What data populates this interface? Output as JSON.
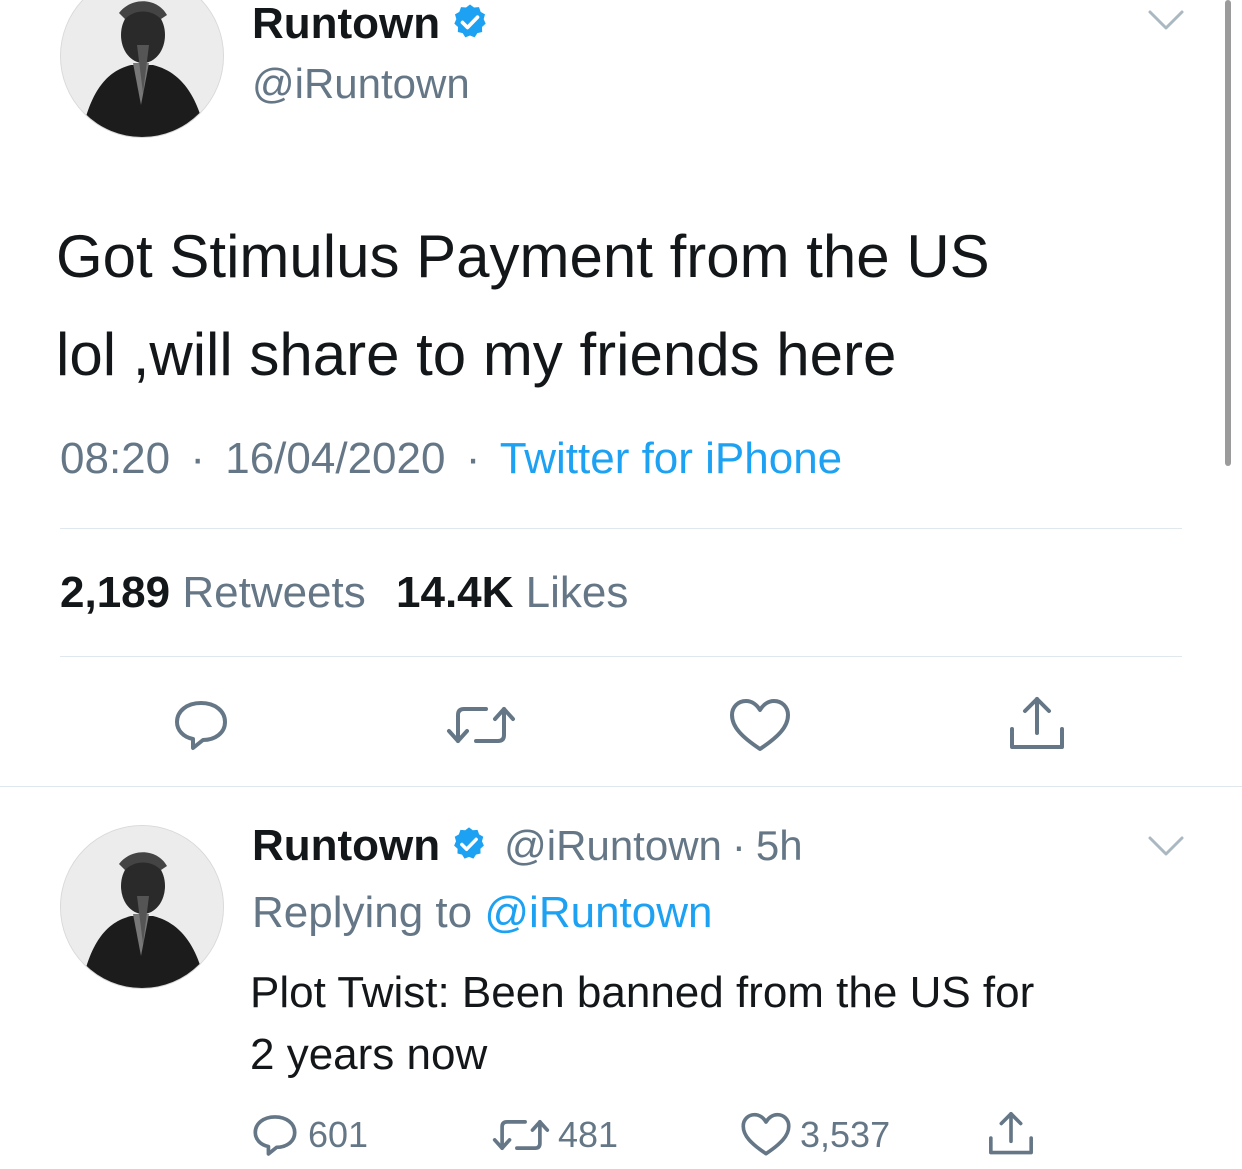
{
  "main_tweet": {
    "display_name": "Runtown",
    "handle": "@iRuntown",
    "text_line1": "Got Stimulus Payment from the US",
    "text_line2": "lol ,will share to my friends here",
    "time": "08:20",
    "date": "16/04/2020",
    "source": "Twitter for iPhone",
    "separator": "·",
    "retweets_count": "2,189",
    "retweets_label": "Retweets",
    "likes_count": "14.4K",
    "likes_label": "Likes"
  },
  "reply_tweet": {
    "display_name": "Runtown",
    "handle": "@iRuntown",
    "separator": "·",
    "age": "5h",
    "replying_prefix": "Replying to",
    "replying_handle": "@iRuntown",
    "text_line1": "Plot Twist: Been banned from the US for",
    "text_line2": "2 years now",
    "reply_count": "601",
    "retweet_count": "481",
    "like_count": "3,537"
  },
  "icons": {
    "verified": "verified-badge-icon",
    "chevron": "chevron-down-icon",
    "reply": "reply-icon",
    "retweet": "retweet-icon",
    "like": "heart-icon",
    "share": "share-icon"
  },
  "colors": {
    "accent": "#1da1f2",
    "text": "#14171a",
    "muted": "#657786",
    "divider": "#e1e8ed"
  }
}
